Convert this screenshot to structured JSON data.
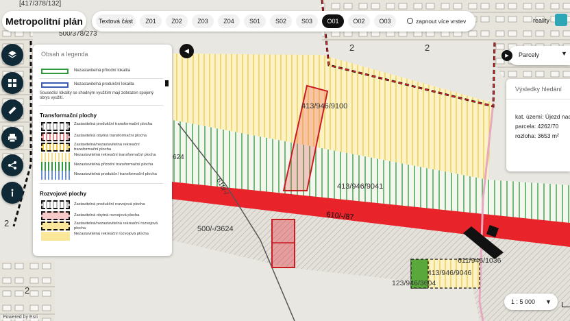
{
  "app": {
    "title": "Metropolitní plán",
    "logo_text": "reality"
  },
  "tabs": [
    {
      "label": "Textová část",
      "active": false
    },
    {
      "label": "Z01",
      "active": false
    },
    {
      "label": "Z02",
      "active": false
    },
    {
      "label": "Z03",
      "active": false
    },
    {
      "label": "Z04",
      "active": false
    },
    {
      "label": "S01",
      "active": false
    },
    {
      "label": "S02",
      "active": false
    },
    {
      "label": "S03",
      "active": false
    },
    {
      "label": "O01",
      "active": true
    },
    {
      "label": "O02",
      "active": false
    },
    {
      "label": "O03",
      "active": false
    }
  ],
  "toggle_layers": {
    "label": "zapnout více vrstev"
  },
  "toolbar": {
    "icons": [
      "layers-icon",
      "grid-icon",
      "ruler-icon",
      "print-icon",
      "share-icon",
      "info-icon"
    ]
  },
  "legend": {
    "header": "Obsah a legenda",
    "rows_top": [
      {
        "text": "Nezastavitelná přírodní lokalita",
        "color": "#2e9a3c"
      },
      {
        "text": "Nezastavitelná produkční lokalita",
        "color": "#3a5bb0"
      }
    ],
    "note": "Sousedící lokality se shodným využitím mají zobrazen spojený obrys využití.",
    "section_transform": {
      "title": "Transformační plochy",
      "items": [
        "Zastavitelná produkční transformační plocha",
        "Zastavitelná obytná transformační plocha",
        "Zastavitelná/nezastavitelná rekreační transformační plocha",
        "Nezastavitelná rekreační transformační plocha",
        "Nezastavitelná přírodní transformační plocha",
        "Nezastavitelná produkční transformační plocha"
      ]
    },
    "section_dev": {
      "title": "Rozvojové plochy",
      "items": [
        "Zastavitelná produkční rozvojová plocha",
        "Zastavitelná obytná rozvojová plocha",
        "Zastavitelná/nezastavitelná rekreační rozvojová plocha",
        "Nezastavitelná rekreační rozvojová plocha"
      ]
    }
  },
  "layer_select": {
    "value": "Parcely"
  },
  "results": {
    "header": "Výsledky hledání",
    "line1": "kat. území: Újezd nad",
    "line2": "parcela: 4262/70",
    "line3": "rozloha: 3653 m²"
  },
  "scale": {
    "value": "1 : 5 000"
  },
  "attribution": "Powered by Esri",
  "map_labels": {
    "l1": "413/946/9100",
    "l2": "413/946/9041",
    "l3": "610/-/87",
    "l4": "500/-/3624",
    "l5": "611/946/1036",
    "l6": "413/946/9046",
    "l7": "123/946/3604",
    "l8": "[417/378/132]",
    "l9": "500/378/273",
    "l10": "624",
    "l11": "610/-/",
    "num": "2"
  },
  "colors": {
    "accent": "#111111",
    "red_road": "#e8232a",
    "green_hatch": "#2e9a3c",
    "yellow_hatch": "#f3d24a",
    "results_accent": "#2fa6b5"
  }
}
